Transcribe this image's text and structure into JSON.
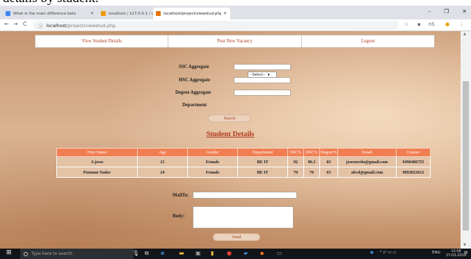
{
  "caption": "details by student.",
  "browser": {
    "tabs": [
      {
        "title": "What is the main difference betv",
        "color": "#4285f4"
      },
      {
        "title": "localhost / 127.0.0.1 / campus /",
        "color": "#f29900"
      },
      {
        "title": "localhost/project/viewstud.php",
        "color": "#e8710a"
      }
    ],
    "new_tab": "+",
    "url_host": "localhost",
    "url_path": "/project/viewstud.php",
    "profile_text": "nS"
  },
  "menu": {
    "items": [
      "View Student Details",
      "Post New Vacancy",
      "Logout"
    ]
  },
  "filter": {
    "ssc_label": "SSC Aggregate",
    "hsc_label": "HSC Aggregate",
    "degree_label": "Degree Aggregate",
    "department_label": "Department",
    "department_selected": "--Select--",
    "search_label": "Search"
  },
  "student_details_title": "Student Details",
  "table": {
    "headers": [
      "First Name",
      "Age",
      "Gender",
      "Department",
      "SSC%",
      "HSC%",
      "Degree%",
      "Email",
      "Contact"
    ],
    "rows": [
      [
        "A jesse",
        "21",
        "Female",
        "BE IT",
        "92",
        "96.3",
        "83",
        "jeseeneelu@gmail.com",
        "9490486755"
      ],
      [
        "Poonam Yadav",
        "24",
        "Female",
        "BE IT",
        "70",
        "76",
        "65",
        "abcd@gmail.com",
        "9892823612"
      ]
    ]
  },
  "mail": {
    "mailto_label": "MailTo:",
    "body_label": "Body:",
    "send_label": "Send"
  },
  "taskbar": {
    "search_placeholder": "Type here to search",
    "tray_lang": "ENG",
    "time": "12:58",
    "date": "27-03-2019"
  },
  "colors": {
    "accent": "#b23a1c",
    "table_header": "#f07e52",
    "table_cell": "#e3c2a6"
  }
}
